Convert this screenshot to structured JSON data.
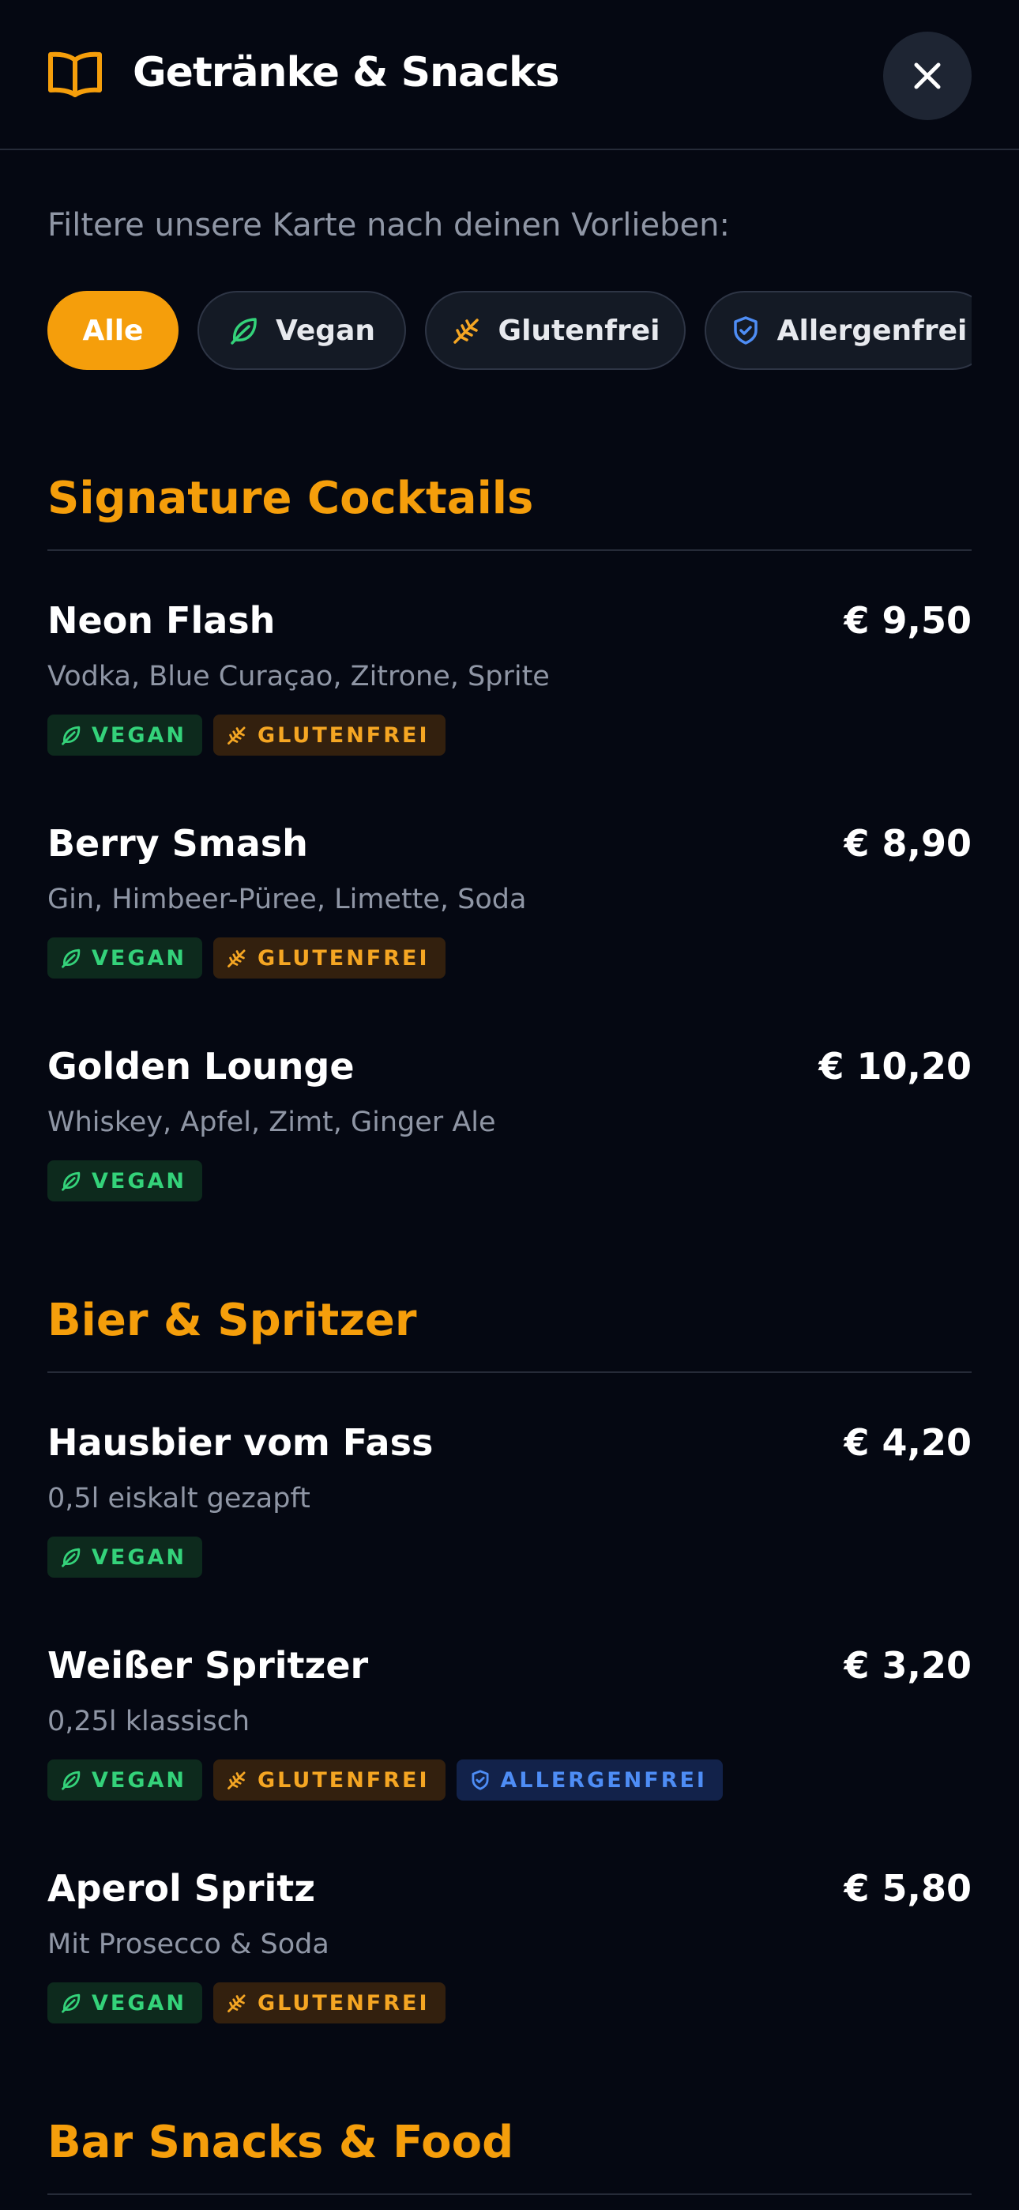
{
  "header": {
    "title": "Getränke & Snacks",
    "book_icon": "book-open-icon",
    "close_icon": "close-icon"
  },
  "filter": {
    "intro": "Filtere unsere Karte nach deinen Vorlieben:",
    "chips": [
      {
        "label": "Alle",
        "active": true
      },
      {
        "label": "Vegan",
        "icon": "leaf-icon"
      },
      {
        "label": "Glutenfrei",
        "icon": "wheat-icon"
      },
      {
        "label": "Allergenfrei",
        "icon": "shield-icon"
      }
    ]
  },
  "tags": {
    "vegan": "VEGAN",
    "gluten": "GLUTENFREI",
    "allergen": "ALLERGENFREI"
  },
  "colors": {
    "accent": "#f59e0b",
    "vegan": "#34d27a",
    "gluten": "#f5a623",
    "allergen": "#4e8df5",
    "background": "#050812"
  },
  "sections": [
    {
      "title": "Signature Cocktails",
      "items": [
        {
          "name": "Neon Flash",
          "price": "€ 9,50",
          "desc": "Vodka, Blue Curaçao, Zitrone, Sprite"
        },
        {
          "name": "Berry Smash",
          "price": "€ 8,90",
          "desc": "Gin, Himbeer-Püree, Limette, Soda"
        },
        {
          "name": "Golden Lounge",
          "price": "€ 10,20",
          "desc": "Whiskey, Apfel, Zimt, Ginger Ale"
        }
      ]
    },
    {
      "title": "Bier & Spritzer",
      "items": [
        {
          "name": "Hausbier vom Fass",
          "price": "€ 4,20",
          "desc": "0,5l eiskalt gezapft"
        },
        {
          "name": "Weißer Spritzer",
          "price": "€ 3,20",
          "desc": "0,25l klassisch"
        },
        {
          "name": "Aperol Spritz",
          "price": "€ 5,80",
          "desc": "Mit Prosecco & Soda"
        }
      ]
    },
    {
      "title": "Bar Snacks & Food"
    }
  ]
}
